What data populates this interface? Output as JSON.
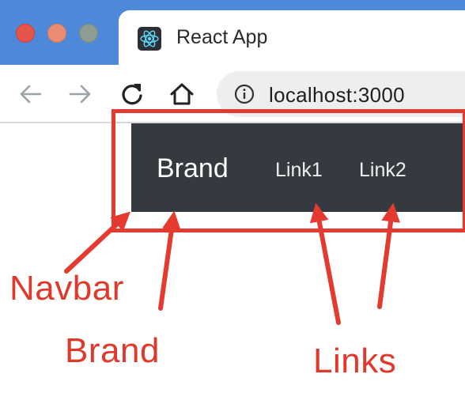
{
  "window": {
    "controls": [
      "close",
      "minimize",
      "maximize"
    ]
  },
  "tab": {
    "title": "React App",
    "favicon": "react-logo-icon"
  },
  "toolbar": {
    "back_icon": "back-arrow-icon",
    "forward_icon": "forward-arrow-icon",
    "reload_icon": "reload-icon",
    "home_icon": "home-icon",
    "info_icon": "info-icon",
    "url": "localhost:3000"
  },
  "navbar": {
    "brand": "Brand",
    "links": [
      "Link1",
      "Link2"
    ],
    "background": "#343a40"
  },
  "annotations": {
    "navbar_label": "Navbar",
    "brand_label": "Brand",
    "links_label": "Links",
    "color": "#e53a2f"
  },
  "colors": {
    "tabstrip": "#4e88d8",
    "close": "#e5544d",
    "minimize": "#e98c73",
    "maximize": "#8e9c96"
  }
}
